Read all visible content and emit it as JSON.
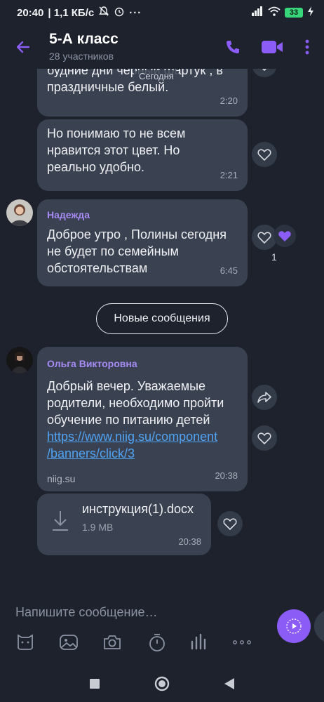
{
  "status_bar": {
    "time": "20:40",
    "network_speed": "| 1,1 КБ/с",
    "battery_level": "33",
    "icons": [
      "mute-icon",
      "alarm-icon",
      "more-dots-icon",
      "signal-icon",
      "wifi-icon",
      "battery-icon",
      "charging-icon"
    ]
  },
  "header": {
    "title": "5-А класс",
    "subtitle": "28 участников",
    "icons": [
      "back-arrow-icon",
      "phone-icon",
      "video-icon",
      "kebab-menu-icon"
    ]
  },
  "chat": {
    "date_label": "Сегодня",
    "messages": [
      {
        "text": "будние дни черный фартук , в\nпраздничные белый.",
        "time": "2:20"
      },
      {
        "text": "Но понимаю то не всем\nнравится этот цвет. Но\nреально удобно.",
        "time": "2:21"
      },
      {
        "sender": "Надежда",
        "text": "Доброе утро , Полины сегодня\nне будет по семейным\nобстоятельствам",
        "time": "6:45",
        "likes": "1"
      },
      {
        "sender": "Ольга Викторовна",
        "text": "Добрый вечер. Уважаемые\nродители, необходимо пройти\nобучение по питанию детей",
        "link": "https://www.niig.su/component\n/banners/click/3",
        "domain": "niig.su",
        "time": "20:38"
      }
    ],
    "new_messages_label": "Новые сообщения",
    "file": {
      "name": "инструкция(1).docx",
      "size": "1.9 MB",
      "time": "20:38"
    }
  },
  "composer": {
    "placeholder": "Напишите сообщение…",
    "toolbar_icons": [
      "sticker-icon",
      "gallery-icon",
      "camera-icon",
      "timer-icon",
      "voice-bars-icon",
      "more-horizontal-icon"
    ]
  },
  "colors": {
    "accent": "#8b5cf6",
    "background": "#1d222d",
    "bubble": "#3a4150",
    "link": "#4fa3f5",
    "sender": "#a68bf5"
  }
}
